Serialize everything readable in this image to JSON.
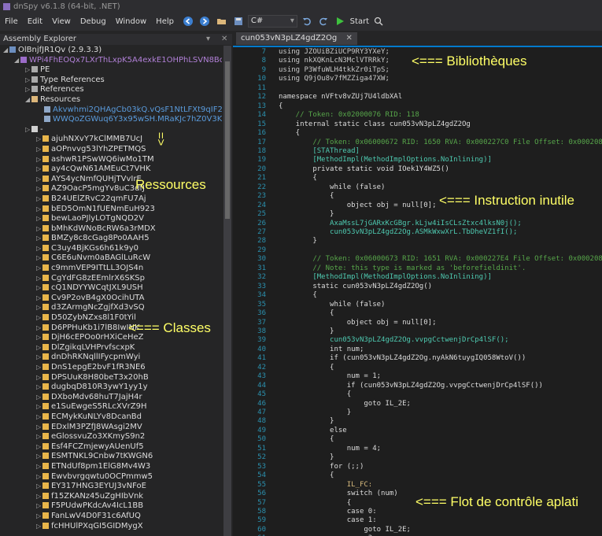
{
  "window": {
    "title": "dnSpy v6.1.8 (64-bit, .NET)"
  },
  "menu": [
    "File",
    "Edit",
    "View",
    "Debug",
    "Window",
    "Help"
  ],
  "toolbar": {
    "language": "C#",
    "start_label": "Start"
  },
  "explorer": {
    "title": "Assembly Explorer",
    "assembly": "OlBnjfJR1Qv (2.9.3.3)",
    "module": "WPi4FhEOQx7LXrThLxpK5A4exkE1OHPhLSVN8Bc5o",
    "children": [
      "PE",
      "Type References",
      "References",
      "Resources"
    ],
    "resources": [
      "Akvwhmi2QHAgCb03kQ.vQsF1NtLFXt9qIF2f5",
      "WWQoZGWuq6Y3x95wSH.MRaKJc7hZ0V3KYuAsD"
    ],
    "root_ns": "-",
    "classes": [
      "ajuhNXvY7kClMMB7UcJ",
      "aOPnvvg53lYhZPETMQS",
      "ashwR1PSwWQ6iwMo1TM",
      "ay4cQwN61AMEuCt7VHK",
      "AYS4ycNmfQUHjTVvIrE",
      "AZ9OacP5mgYv8uC3dfJ",
      "B24UElZRvC22qmFU7Aj",
      "bED5OmN1fUENmEuH923",
      "bewLaoPJlyLOTgNQD2V",
      "bMhKdWNoBcRW6a3rMDX",
      "BMZy8c8cGag8Po0AAH5",
      "C3uy4BjKGs6h61k9y0",
      "C6E6uNvm0aBAGlLuRcW",
      "c9mmVEP9ITtLL3OJS4n",
      "CgYdFG8zEEmlrX6SKSp",
      "cQ1NDYYWCqtJXL9USH",
      "Cv9P2ovB4gX0OcihUTA",
      "d3ZArmgNcZgjfXd3vSQ",
      "D50ZybNZxs8l1F0tYil",
      "D6PPHuKb1i7lB8IwINK",
      "DjH6cEPOo0rHXiCeHeZ",
      "DlZgikqLVHPrvfscxpK",
      "dnDhRKNqllIFycpmWyi",
      "DnS1epgE2bvF1fR3NE6",
      "DPSUuK8H80beT3x20hB",
      "dugbqD810R3ywY1yy1y",
      "DXboMdv68huT7JajH4r",
      "e1SuEwgeS5RLcXVrZ9H",
      "ECMykKuNLYv8DcanBd",
      "EDxlM3PZfJ8WAsgi2MV",
      "eGlossvuZo3XKmyS9n2",
      "Esf4FCZmjewyAUenUf5",
      "ESMTNKL9Cnbw7tKWGN6",
      "ETNdUf8pm1ElG8Mv4W3",
      "Ewvbvrgqwtu0OCPmmw5",
      "EY317HNG3EYUJ3vNFoE",
      "f15ZKANz45uZgHIbVnk",
      "F5PUdwPKdcAv4IcL1BB",
      "FanLwV4D0F31c6AfUQ",
      "fcHHUlPXqGI5GIDMygX"
    ]
  },
  "editor": {
    "tab_title": "cun053vN3pLZ4gdZ2Og",
    "lines": [
      {
        "n": 7,
        "t": "using JZOUiBZiUCP9RY3YXeY;"
      },
      {
        "n": 8,
        "t": "using nkXQKnLcN3MclVTRRkY;"
      },
      {
        "n": 9,
        "t": "using P3WfuWLH4tkkZr0iTpS;"
      },
      {
        "n": 10,
        "t": "using Q9jOu8v7fMZZiga47XW;"
      },
      {
        "n": 11,
        "t": ""
      },
      {
        "n": 12,
        "t": "namespace nVFtv8vZUj7U4ldbXAl"
      },
      {
        "n": 13,
        "t": "{"
      },
      {
        "n": 14,
        "t": "    // Token: 0x02000076 RID: 118"
      },
      {
        "n": 15,
        "t": "    internal static class cun053vN3pLZ4gdZ2Og"
      },
      {
        "n": 16,
        "t": "    {"
      },
      {
        "n": 17,
        "t": "        // Token: 0x06000672 RID: 1650 RVA: 0x000227C0 File Offset: 0x000208C0"
      },
      {
        "n": 18,
        "t": "        [STAThread]"
      },
      {
        "n": 19,
        "t": "        [MethodImpl(MethodImplOptions.NoInlining)]"
      },
      {
        "n": 20,
        "t": "        private static void IOek1Y4WZ5()"
      },
      {
        "n": 21,
        "t": "        {"
      },
      {
        "n": 22,
        "t": "            while (false)"
      },
      {
        "n": 23,
        "t": "            {"
      },
      {
        "n": 24,
        "t": "                object obj = null[0];"
      },
      {
        "n": 25,
        "t": "            }"
      },
      {
        "n": 26,
        "t": "            AxaMssL7jGARxKcGBgr.kLjw4iIsCLsZtxc4lksN0j();"
      },
      {
        "n": 27,
        "t": "            cun053vN3pLZ4gdZ2Og.ASMkWxwXrL.TbDheVZ1fI();"
      },
      {
        "n": 28,
        "t": "        }"
      },
      {
        "n": 29,
        "t": ""
      },
      {
        "n": 30,
        "t": "        // Token: 0x06000673 RID: 1651 RVA: 0x000227E4 File Offset: 0x000208E4"
      },
      {
        "n": 31,
        "t": "        // Note: this type is marked as 'beforefieldinit'."
      },
      {
        "n": 32,
        "t": "        [MethodImpl(MethodImplOptions.NoInlining)]"
      },
      {
        "n": 33,
        "t": "        static cun053vN3pLZ4gdZ2Og()"
      },
      {
        "n": 34,
        "t": "        {"
      },
      {
        "n": 35,
        "t": "            while (false)"
      },
      {
        "n": 36,
        "t": "            {"
      },
      {
        "n": 37,
        "t": "                object obj = null[0];"
      },
      {
        "n": 38,
        "t": "            }"
      },
      {
        "n": 39,
        "t": "            cun053vN3pLZ4gdZ2Og.vvpgCctwenjDrCp4lSF();"
      },
      {
        "n": 40,
        "t": "            int num;"
      },
      {
        "n": 41,
        "t": "            if (cun053vN3pLZ4gdZ2Og.nyAkN6tuygIQ058WtoV())"
      },
      {
        "n": 42,
        "t": "            {"
      },
      {
        "n": 43,
        "t": "                num = 1;"
      },
      {
        "n": 44,
        "t": "                if (cun053vN3pLZ4gdZ2Og.vvpgCctwenjDrCp4lSF())"
      },
      {
        "n": 45,
        "t": "                {"
      },
      {
        "n": 46,
        "t": "                    goto IL_2E;"
      },
      {
        "n": 47,
        "t": "                }"
      },
      {
        "n": 48,
        "t": "            }"
      },
      {
        "n": 49,
        "t": "            else"
      },
      {
        "n": 50,
        "t": "            {"
      },
      {
        "n": 51,
        "t": "                num = 4;"
      },
      {
        "n": 52,
        "t": "            }"
      },
      {
        "n": 53,
        "t": "            for (;;)"
      },
      {
        "n": 54,
        "t": "            {"
      },
      {
        "n": 55,
        "t": "                IL_FC:"
      },
      {
        "n": 56,
        "t": "                switch (num)"
      },
      {
        "n": 57,
        "t": "                {"
      },
      {
        "n": 58,
        "t": "                case 0:"
      },
      {
        "n": 59,
        "t": "                case 1:"
      },
      {
        "n": 60,
        "t": "                    goto IL_2E;"
      },
      {
        "n": 61,
        "t": "                case 3:"
      },
      {
        "n": 62,
        "t": "                    goto IL_E5;"
      }
    ]
  },
  "annotations": {
    "libraries": "<=== Bibliothèques",
    "useless": "<=== Instruction inutile",
    "resources_arrow": "<=",
    "resources": "Ressources",
    "classes": "<=== Classes",
    "flow": "<=== Flot de contrôle aplati"
  },
  "colors": {
    "accent": "#007acc",
    "annotation": "#ffff66"
  }
}
